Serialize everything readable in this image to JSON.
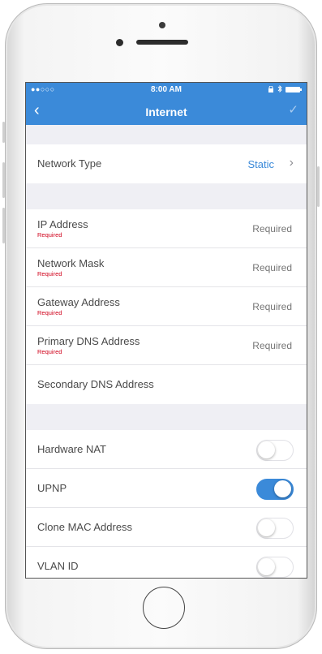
{
  "status_bar": {
    "signal": "●●○○○",
    "time": "8:00 AM"
  },
  "nav": {
    "back_icon": "‹",
    "title": "Internet",
    "done_icon": "✓"
  },
  "network_type": {
    "label": "Network Type",
    "value": "Static",
    "chevron": "›"
  },
  "fields": [
    {
      "label": "IP Address",
      "note": "Required",
      "placeholder": "Required"
    },
    {
      "label": "Network Mask",
      "note": "Required",
      "placeholder": "Required"
    },
    {
      "label": "Gateway Address",
      "note": "Required",
      "placeholder": "Required"
    },
    {
      "label": "Primary DNS Address",
      "note": "Required",
      "placeholder": "Required"
    },
    {
      "label": "Secondary DNS Address"
    }
  ],
  "toggles": [
    {
      "label": "Hardware NAT",
      "on": false
    },
    {
      "label": "UPNP",
      "on": true
    },
    {
      "label": "Clone MAC Address",
      "on": false
    },
    {
      "label": "VLAN ID",
      "on": false
    }
  ],
  "colors": {
    "accent": "#3b8ad9",
    "required": "#d0021b",
    "background": "#efeff4"
  }
}
